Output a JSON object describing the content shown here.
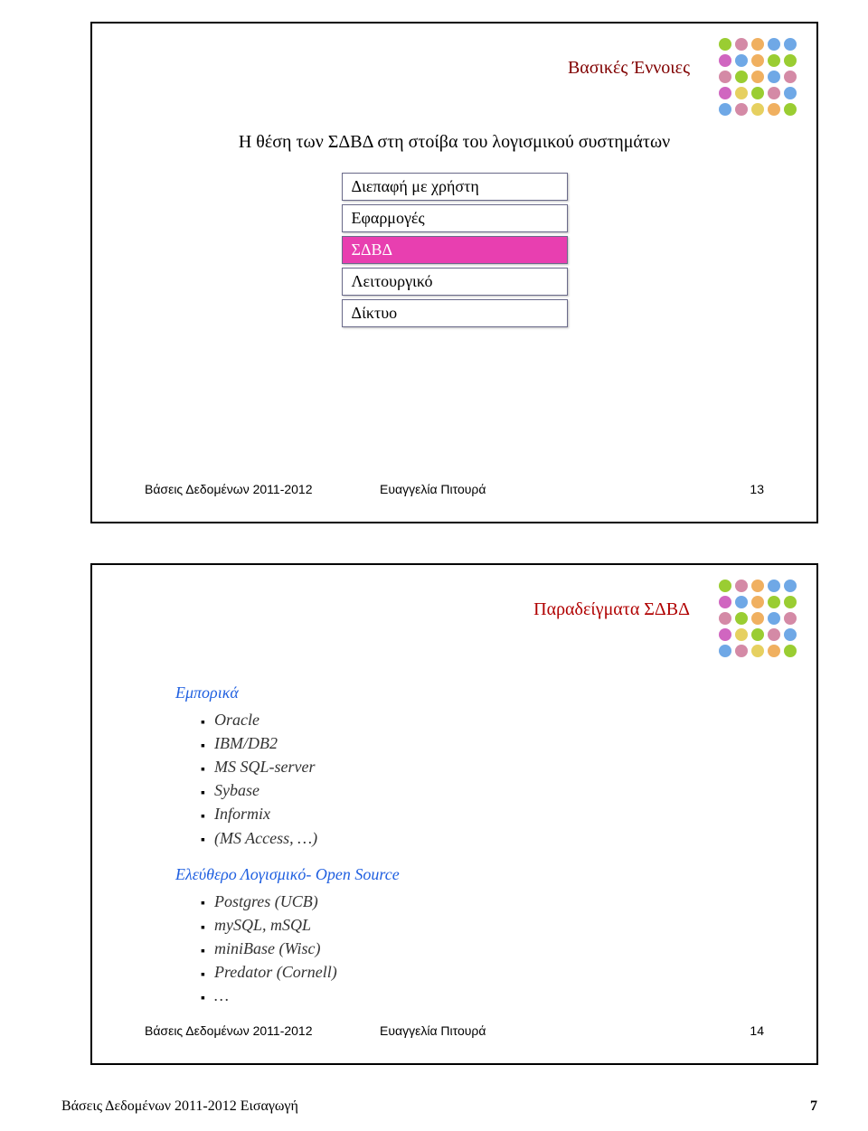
{
  "slide1": {
    "title": "Βασικές Έννοιες",
    "heading": "Η θέση των ΣΔΒΔ στη στοίβα του λογισμικού συστημάτων",
    "stack": [
      "Διεπαφή με χρήστη",
      "Εφαρμογές",
      "ΣΔΒΔ",
      "Λειτουργικό",
      "Δίκτυο"
    ],
    "highlight_index": 2,
    "footer_left": "Βάσεις Δεδομένων 2011-2012",
    "footer_center": "Ευαγγελία Πιτουρά",
    "footer_number": "13"
  },
  "slide2": {
    "title": "Παραδείγματα ΣΔΒΔ",
    "section1_head": "Εμπορικά",
    "section1_items": [
      "Oracle",
      "IBM/DB2",
      "MS SQL-server",
      "Sybase",
      "Informix",
      "(MS Access, …)"
    ],
    "section2_head": "Ελεύθερο Λογισμικό- Open Source",
    "section2_items": [
      "Postgres (UCB)",
      "mySQL, mSQL",
      "miniBase (Wisc)",
      "Predator (Cornell)",
      "…"
    ],
    "footer_left": "Βάσεις Δεδομένων 2011-2012",
    "footer_center": "Ευαγγελία Πιτουρά",
    "footer_number": "14"
  },
  "page_footer_left": "Βάσεις Δεδομένων 2011-2012 Εισαγωγή",
  "page_footer_right": "7"
}
